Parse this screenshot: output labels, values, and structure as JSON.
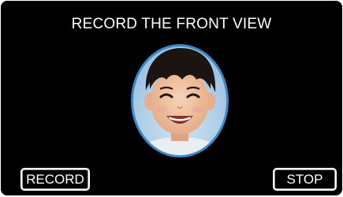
{
  "screen": {
    "title": "RECORD THE FRONT VIEW",
    "background_color": "#000000"
  },
  "face_guide": {
    "frame_color": "#3a88c8",
    "preview_subject": "smiling child face"
  },
  "buttons": {
    "record_label": "RECORD",
    "stop_label": "STOP"
  }
}
